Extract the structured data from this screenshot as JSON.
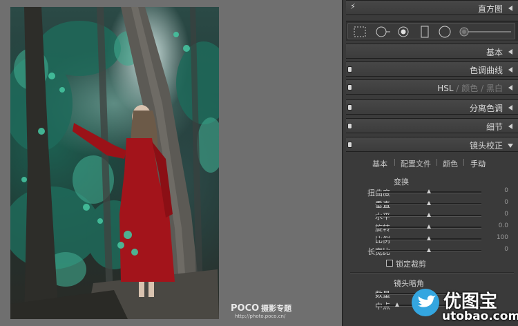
{
  "watermark": {
    "brand": "POCO",
    "brand_sub": "摄影专题",
    "url": "http://photo.poco.cn/"
  },
  "panels": {
    "histogram": "直方图",
    "basic": "基本",
    "tone_curve": "色调曲线",
    "hsl": {
      "hsl": "HSL",
      "sep": "/",
      "color": "颜色",
      "bw": "黑白"
    },
    "split_toning": "分离色调",
    "detail": "细节",
    "lens_correction": "镜头校正"
  },
  "tools": [
    "crop-overlay-icon",
    "spot-removal-icon",
    "red-eye-icon",
    "graduated-filter-icon",
    "radial-filter-icon",
    "adjustment-brush-slider"
  ],
  "lens_tabs": [
    {
      "label": "基本",
      "active": false
    },
    {
      "label": "配置文件",
      "active": false
    },
    {
      "label": "颜色",
      "active": false
    },
    {
      "label": "手动",
      "active": true
    }
  ],
  "transform": {
    "title": "变换",
    "rows": [
      {
        "label": "扭曲度",
        "value": "0",
        "level": 0.5
      },
      {
        "label": "垂直",
        "value": "0",
        "level": 0.5
      },
      {
        "label": "水平",
        "value": "0",
        "level": 0.5
      },
      {
        "label": "旋转",
        "value": "0.0",
        "level": 0.5
      },
      {
        "label": "比例",
        "value": "100",
        "level": 0.5
      },
      {
        "label": "长宽比",
        "value": "0",
        "level": 0.5
      }
    ],
    "lock_crop": "锁定裁剪"
  },
  "vignetting": {
    "title": "镜头暗角",
    "rows": [
      {
        "label": "数量",
        "value": "",
        "level": 0.5
      },
      {
        "label": "中点",
        "value": "",
        "level": 0.2
      }
    ]
  },
  "site_logo": {
    "cn": "优图宝",
    "en": "utobao.com"
  }
}
